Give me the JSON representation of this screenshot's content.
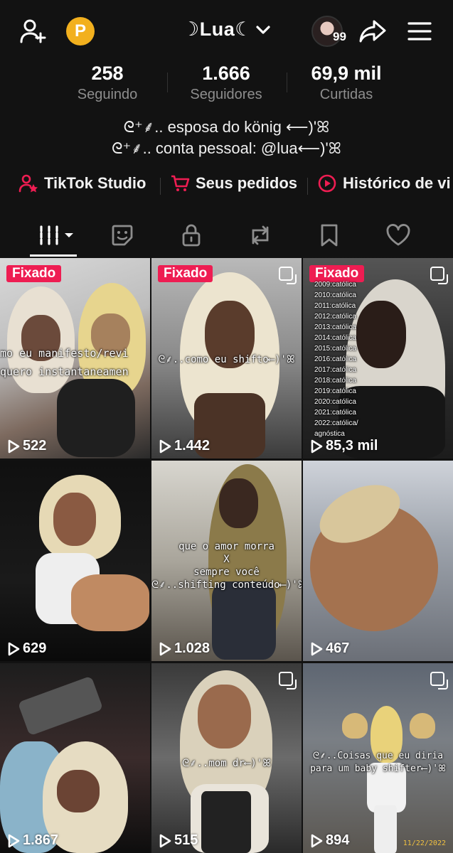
{
  "header": {
    "title": "☽Lua☾",
    "avatar_count": "99",
    "p_badge": "P",
    "icons": [
      "add-user-icon",
      "points-badge-icon",
      "chevron-down-icon",
      "share-icon",
      "menu-icon"
    ]
  },
  "stats": [
    {
      "value": "258",
      "label": "Seguindo"
    },
    {
      "value": "1.666",
      "label": "Seguidores"
    },
    {
      "value": "69,9 mil",
      "label": "Curtidas"
    }
  ],
  "bio": {
    "line1": "ᘓ⁺⸙.. esposa do könig ⟵)'ꕤ",
    "line2": "ᘓ⁺⸙.. conta pessoal: @lua⟵)'ꕤ"
  },
  "links": [
    {
      "label": "TikTok Studio",
      "icon": "tiktok-studio-icon"
    },
    {
      "label": "Seus pedidos",
      "icon": "cart-icon"
    },
    {
      "label": "Histórico de vi",
      "icon": "play-history-icon"
    }
  ],
  "tabs": [
    "videos-grid-icon",
    "stickers-icon",
    "lock-icon",
    "repost-icon",
    "bookmark-icon",
    "heart-icon"
  ],
  "colors": {
    "background": "#121212",
    "accent": "#ee1d52",
    "muted": "#8d8d8d",
    "gold": "#f2b01e"
  },
  "videos": [
    {
      "views": "522",
      "pinned": "Fixado",
      "caption": "mo eu manifesto/revi\nquero instantaneamen"
    },
    {
      "views": "1.442",
      "pinned": "Fixado",
      "caption": "ᘓ⸙..como eu shifto⟵)'ꕤ"
    },
    {
      "views": "85,3 mil",
      "pinned": "Fixado",
      "caption": "2009:católica\n2010:católica\n2011:católica\n2012:católica\n2013:católica\n2014:católica\n2015:católica\n2016:católica\n2017:católica\n2018:católica\n2019:católica\n2020:católica\n2021:católica\n2022:católica/\nagnóstica"
    },
    {
      "views": "629",
      "pinned": "",
      "caption": ""
    },
    {
      "views": "1.028",
      "pinned": "",
      "caption": "que o amor morra\nX\nsempre você\nᘓ⸙..shifting conteúdo⟵)'ꕤ"
    },
    {
      "views": "467",
      "pinned": "",
      "caption": ""
    },
    {
      "views": "1.867",
      "pinned": "",
      "caption": ""
    },
    {
      "views": "515",
      "pinned": "",
      "caption": "ᘓ⸙..mom dr⟵)'ꕤ"
    },
    {
      "views": "894",
      "pinned": "",
      "caption": "ᘓ⸙..Coisas que eu diria\npara um baby shifter⟵)'ꕤ",
      "stamp": "11/22/2022"
    }
  ]
}
